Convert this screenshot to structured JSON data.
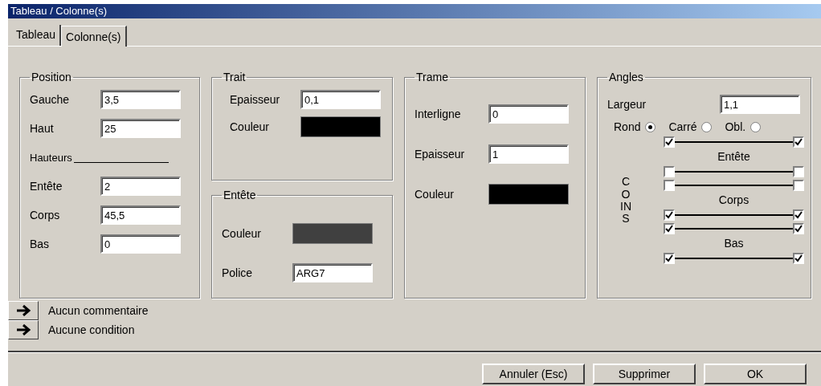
{
  "window": {
    "title": "Tableau / Colonne(s)"
  },
  "tabs": [
    {
      "label": "Tableau",
      "selected": true
    },
    {
      "label": "Colonne(s)",
      "selected": false
    }
  ],
  "columns": [
    [
      {
        "title": "Position",
        "items": [
          {
            "kind": "field",
            "label": "Gauche",
            "value": "3,5"
          },
          {
            "kind": "field",
            "label": "Haut",
            "value": "25"
          },
          {
            "kind": "heading",
            "label": "Hauteurs"
          },
          {
            "kind": "field",
            "label": "Entête",
            "value": "2"
          },
          {
            "kind": "field",
            "label": "Corps",
            "value": "45,5"
          },
          {
            "kind": "field",
            "label": "Bas",
            "value": "0"
          }
        ]
      }
    ],
    [
      {
        "title": "Trait",
        "items": [
          {
            "kind": "field",
            "label": "Epaisseur",
            "value": "0,1"
          },
          {
            "kind": "color",
            "label": "Couleur",
            "color": "#000000"
          }
        ]
      },
      {
        "title": "Entête",
        "items": [
          {
            "kind": "color",
            "label": "Couleur",
            "color": "#404040"
          },
          {
            "kind": "field",
            "label": "Police",
            "value": "ARG7"
          }
        ]
      }
    ],
    [
      {
        "title": "Trame",
        "items": [
          {
            "kind": "field",
            "label": "Interligne",
            "value": "0"
          },
          {
            "kind": "field",
            "label": "Epaisseur",
            "value": "1"
          },
          {
            "kind": "color",
            "label": "Couleur",
            "color": "#000000"
          }
        ]
      }
    ]
  ],
  "angles": {
    "title": "Angles",
    "width_label": "Largeur",
    "width_value": "1,1",
    "shapes": [
      {
        "label": "Rond",
        "selected": true
      },
      {
        "label": "Carré",
        "selected": false
      },
      {
        "label": "Obl.",
        "selected": false
      }
    ],
    "corners_label": "COINS",
    "sections": [
      {
        "label": "Entête",
        "top": {
          "left": true,
          "right": true
        },
        "bottom": {
          "left": false,
          "right": false
        }
      },
      {
        "label": "Corps",
        "top": {
          "left": false,
          "right": false
        },
        "bottom": {
          "left": true,
          "right": true
        }
      },
      {
        "label": "Bas",
        "top": {
          "left": true,
          "right": true
        },
        "bottom": {
          "left": true,
          "right": true
        }
      }
    ]
  },
  "notes": [
    {
      "label": "Aucun commentaire"
    },
    {
      "label": "Aucune condition"
    }
  ],
  "buttons": [
    {
      "label": "Annuler (Esc)"
    },
    {
      "label": "Supprimer"
    },
    {
      "label": "OK"
    }
  ]
}
